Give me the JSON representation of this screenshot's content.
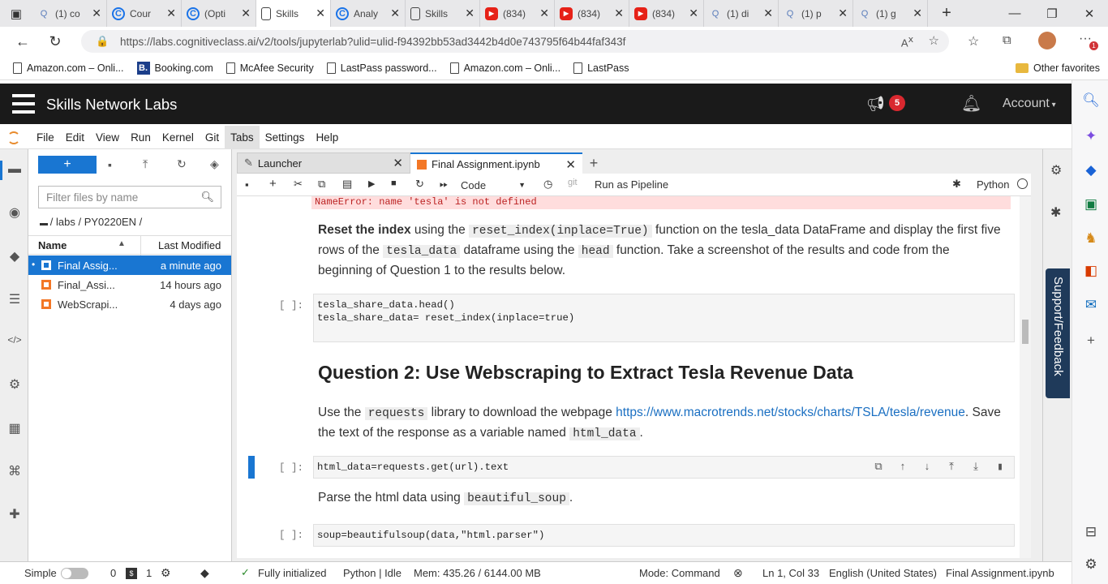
{
  "browser": {
    "tabs": [
      {
        "title": "(1) co",
        "icon": "search-icon",
        "color": "#5a7dbb"
      },
      {
        "title": "Cour",
        "icon": "coursera-icon",
        "color": "#1a73e8"
      },
      {
        "title": "(Opti",
        "icon": "coursera-icon",
        "color": "#1a73e8"
      },
      {
        "title": "Skills",
        "icon": "document-icon",
        "color": "#444444",
        "active": true
      },
      {
        "title": "Analy",
        "icon": "coursera-icon",
        "color": "#1a73e8"
      },
      {
        "title": "Skills",
        "icon": "document-icon",
        "color": "#444444"
      },
      {
        "title": "(834)",
        "icon": "youtube-icon",
        "color": "#e62117"
      },
      {
        "title": "(834)",
        "icon": "youtube-icon",
        "color": "#e62117"
      },
      {
        "title": "(834)",
        "icon": "youtube-icon",
        "color": "#e62117"
      },
      {
        "title": "(1) di",
        "icon": "search-icon",
        "color": "#5a7dbb"
      },
      {
        "title": "(1) p",
        "icon": "search-icon",
        "color": "#5a7dbb"
      },
      {
        "title": "(1) g",
        "icon": "search-icon",
        "color": "#5a7dbb"
      }
    ],
    "url": "https://labs.cognitiveclass.ai/v2/tools/jupyterlab?ulid=ulid-f94392bb53ad3442b4d0e743795f64b44faf343f",
    "profile_badge": "1",
    "bookmarks": [
      {
        "label": "Amazon.com – Onli...",
        "icon": "document-icon"
      },
      {
        "label": "Booking.com",
        "icon": "booking-icon"
      },
      {
        "label": "McAfee Security",
        "icon": "document-icon"
      },
      {
        "label": "LastPass password...",
        "icon": "document-icon"
      },
      {
        "label": "Amazon.com – Onli...",
        "icon": "document-icon"
      },
      {
        "label": "LastPass",
        "icon": "document-icon"
      }
    ],
    "other_favorites": "Other favorites"
  },
  "header": {
    "title": "Skills Network Labs",
    "notif_count": "5",
    "account": "Account"
  },
  "menu": [
    "File",
    "Edit",
    "View",
    "Run",
    "Kernel",
    "Git",
    "Tabs",
    "Settings",
    "Help"
  ],
  "filebrowser": {
    "new_label": "+",
    "filter_placeholder": "Filter files by name",
    "breadcrumb": "/ labs / PY0220EN /",
    "col_name": "Name",
    "col_modified": "Last Modified",
    "files": [
      {
        "name": "Final Assig...",
        "modified": "a minute ago",
        "selected": true
      },
      {
        "name": "Final_Assi...",
        "modified": "14 hours ago"
      },
      {
        "name": "WebScrapi...",
        "modified": "4 days ago"
      }
    ]
  },
  "notebook": {
    "tabs": [
      {
        "label": "Launcher",
        "icon": "launcher-icon"
      },
      {
        "label": "Final Assignment.ipynb",
        "icon": "notebook-icon",
        "active": true
      }
    ],
    "celltype": "Code",
    "git_label": "git",
    "pipeline": "Run as Pipeline",
    "kernel": "Python",
    "error_text": "NameError: name 'tesla' is not defined",
    "md1_bold": "Reset the index",
    "md1_a": " using the ",
    "md1_code1": "reset_index(inplace=True)",
    "md1_b": " function on the tesla_data DataFrame and display the first five rows of the ",
    "md1_code2": "tesla_data",
    "md1_c": " dataframe using the ",
    "md1_code3": "head",
    "md1_d": " function. Take a screenshot of the results and code from the beginning of Question 1 to the results below.",
    "cell1_prompt": "[ ]:",
    "cell1_line1": "tesla_share_data.head()",
    "cell1_line2": "tesla_share_data= reset_index(inplace=true)",
    "q2_heading": "Question 2: Use Webscraping to Extract Tesla Revenue Data",
    "md2_a": "Use the ",
    "md2_code1": "requests",
    "md2_b": " library to download the webpage ",
    "md2_link": "https://www.macrotrends.net/stocks/charts/TSLA/tesla/revenue",
    "md2_c": ". Save the text of the response as a variable named ",
    "md2_code2": "html_data",
    "md2_d": ".",
    "cell2_prompt": "[ ]:",
    "cell2_code": "html_data=requests.get(url).text",
    "md3_a": "Parse the html data using ",
    "md3_code": "beautiful_soup",
    "md3_b": ".",
    "cell3_prompt": "[ ]:",
    "cell3_code": "soup=beautifulsoup(data,\"html.parser\")"
  },
  "support_feedback": "Support/Feedback",
  "status": {
    "mode_simple": "Simple",
    "kernels": "0",
    "terminals": "1",
    "init": "Fully initialized",
    "kernel_state": "Python | Idle",
    "mem": "Mem: 435.26 / 6144.00 MB",
    "mode": "Mode: Command",
    "position": "Ln 1, Col 33",
    "language": "English (United States)",
    "file": "Final Assignment.ipynb"
  }
}
